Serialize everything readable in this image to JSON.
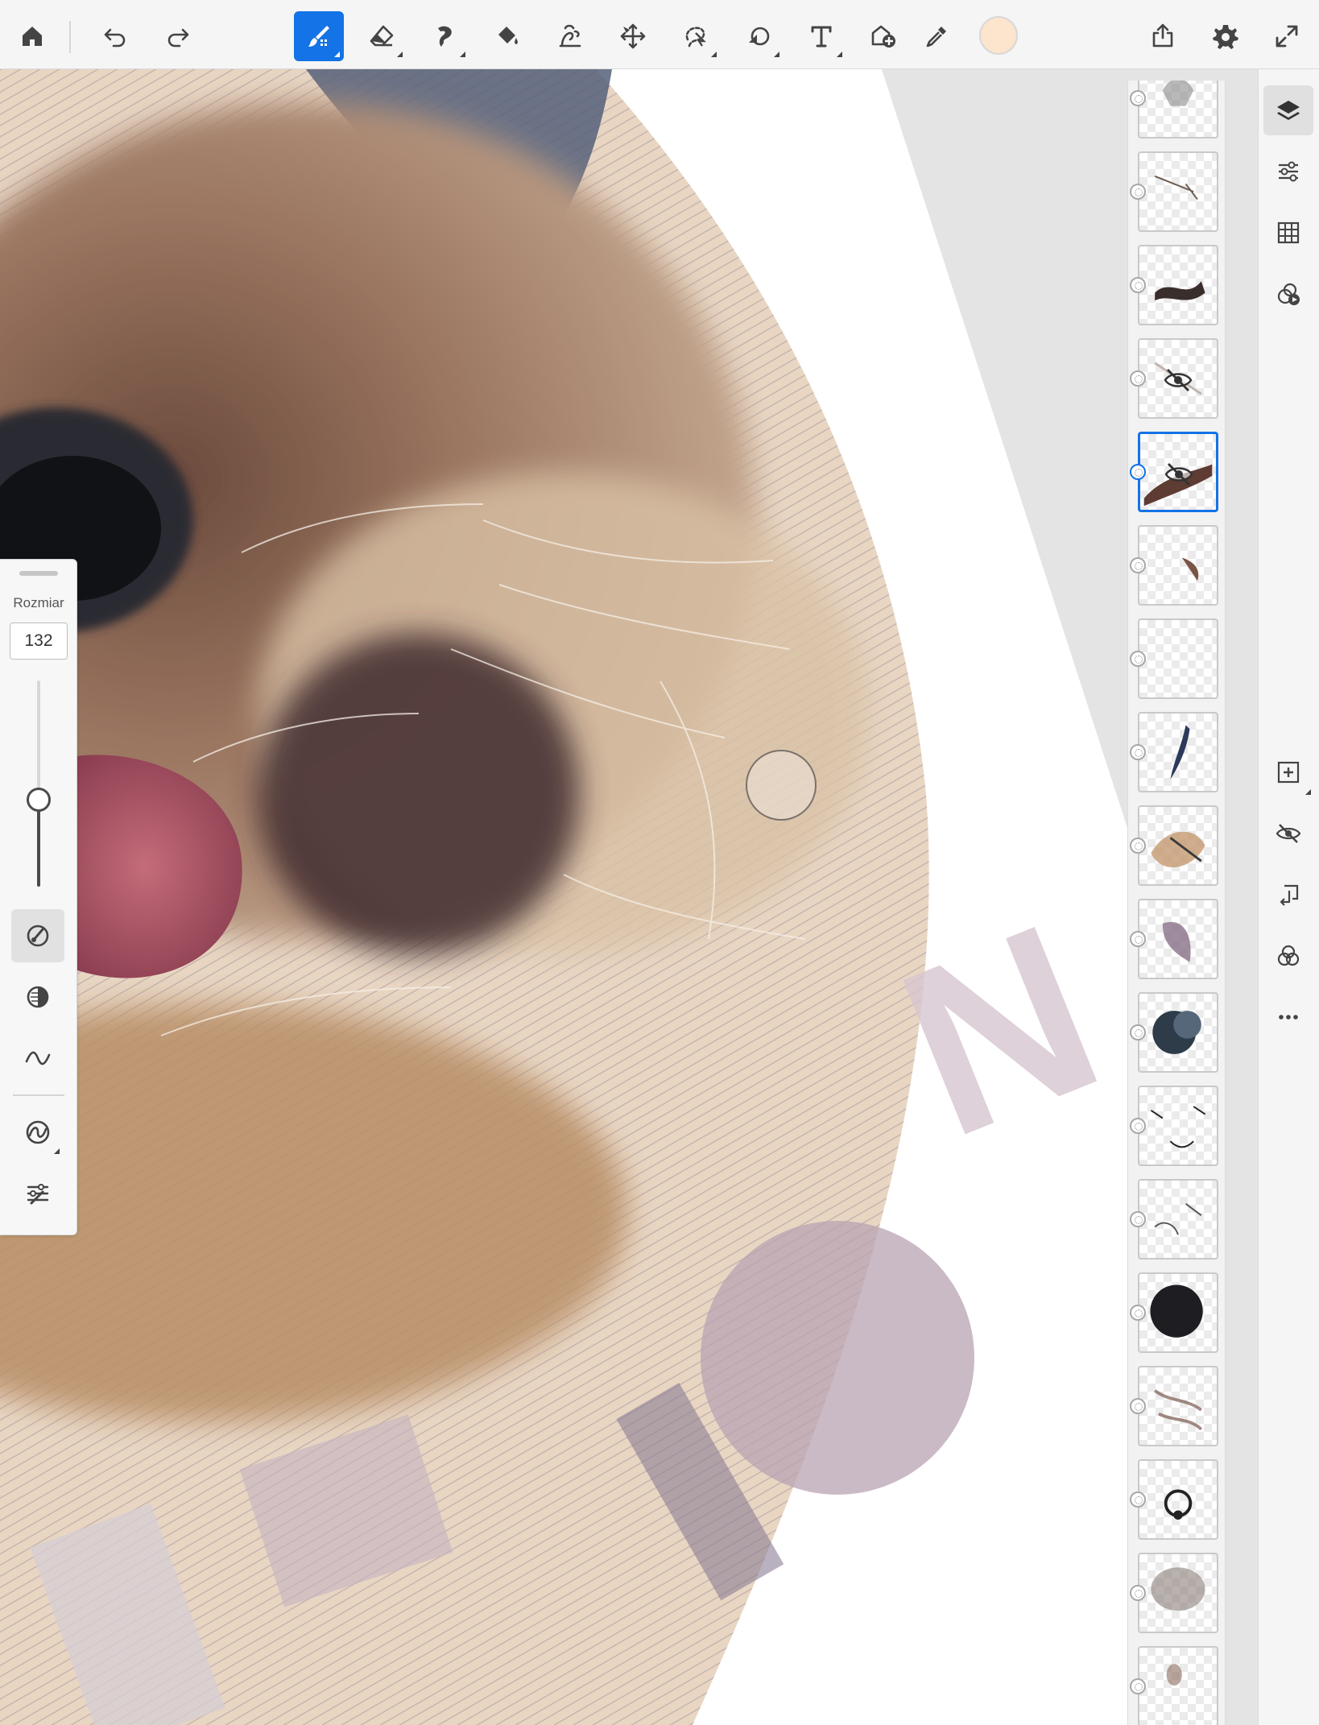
{
  "toolbar": {
    "tools": [
      {
        "id": "home",
        "icon": "home-icon"
      },
      {
        "id": "undo",
        "icon": "undo-icon"
      },
      {
        "id": "redo",
        "icon": "redo-icon"
      },
      {
        "id": "brush",
        "icon": "paint-brush-icon",
        "active": true
      },
      {
        "id": "eraser",
        "icon": "eraser-icon"
      },
      {
        "id": "smudge",
        "icon": "smudge-icon"
      },
      {
        "id": "fill",
        "icon": "paint-bucket-icon"
      },
      {
        "id": "liquify",
        "icon": "liquify-icon"
      },
      {
        "id": "transform",
        "icon": "move-transform-icon"
      },
      {
        "id": "selection",
        "icon": "lasso-selection-icon"
      },
      {
        "id": "shape",
        "icon": "shape-icon"
      },
      {
        "id": "text",
        "icon": "text-icon"
      },
      {
        "id": "place-image",
        "icon": "add-image-icon"
      },
      {
        "id": "eyedropper",
        "icon": "eyedropper-icon"
      }
    ],
    "current_color": "#fce4cd",
    "share_icon": "share-icon",
    "settings_icon": "gear-icon",
    "fullscreen_icon": "fullscreen-icon",
    "accent_color": "#1473e6"
  },
  "brush_panel": {
    "size_label": "Rozmiar",
    "size_value": "132",
    "size_level": 0.42,
    "buttons": [
      {
        "id": "brush-settings",
        "icon": "brush-dial-icon",
        "active": true
      },
      {
        "id": "opacity",
        "icon": "opacity-icon"
      },
      {
        "id": "smoothing",
        "icon": "smoothing-icon"
      },
      {
        "id": "brush-presets",
        "icon": "brush-presets-icon"
      },
      {
        "id": "brush-adjust",
        "icon": "brush-adjust-icon"
      }
    ]
  },
  "layers": {
    "selected_index": 4,
    "items": [
      {
        "id": 1,
        "thumb": "dog-ear-sketch",
        "hidden": false
      },
      {
        "id": 2,
        "thumb": "thin-strokes",
        "hidden": false
      },
      {
        "id": 3,
        "thumb": "dark-brush-strokes",
        "hidden": false
      },
      {
        "id": 4,
        "thumb": "faint-strokes",
        "hidden": true
      },
      {
        "id": 5,
        "thumb": "brown-stroke",
        "hidden": true
      },
      {
        "id": 6,
        "thumb": "small-brown-strokes",
        "hidden": false
      },
      {
        "id": 7,
        "thumb": "empty",
        "hidden": false
      },
      {
        "id": 8,
        "thumb": "blue-feather",
        "hidden": false
      },
      {
        "id": 9,
        "thumb": "tan-wash",
        "hidden": false
      },
      {
        "id": 10,
        "thumb": "mauve-wash",
        "hidden": false
      },
      {
        "id": 11,
        "thumb": "dark-blue-blob",
        "hidden": false
      },
      {
        "id": 12,
        "thumb": "dog-face-lines",
        "hidden": false
      },
      {
        "id": 13,
        "thumb": "light-strokes",
        "hidden": false
      },
      {
        "id": 14,
        "thumb": "black-blob",
        "hidden": false
      },
      {
        "id": 15,
        "thumb": "fur-strokes",
        "hidden": false
      },
      {
        "id": 16,
        "thumb": "nose-sketch",
        "hidden": false
      },
      {
        "id": 17,
        "thumb": "soft-grey-smudge",
        "hidden": false
      },
      {
        "id": 18,
        "thumb": "small-smudge",
        "hidden": false
      }
    ]
  },
  "rail": {
    "buttons": [
      {
        "id": "layers",
        "icon": "layers-icon",
        "active": true
      },
      {
        "id": "adjustments",
        "icon": "sliders-icon"
      },
      {
        "id": "grid",
        "icon": "grid-icon"
      },
      {
        "id": "timelapse",
        "icon": "timelapse-icon"
      },
      {
        "id": "add-layer",
        "icon": "add-layer-icon"
      },
      {
        "id": "layer-visibility",
        "icon": "eye-hidden-icon"
      },
      {
        "id": "merge-down",
        "icon": "merge-down-icon"
      },
      {
        "id": "blend-mode",
        "icon": "blend-mode-icon"
      },
      {
        "id": "more",
        "icon": "more-icon"
      }
    ]
  }
}
